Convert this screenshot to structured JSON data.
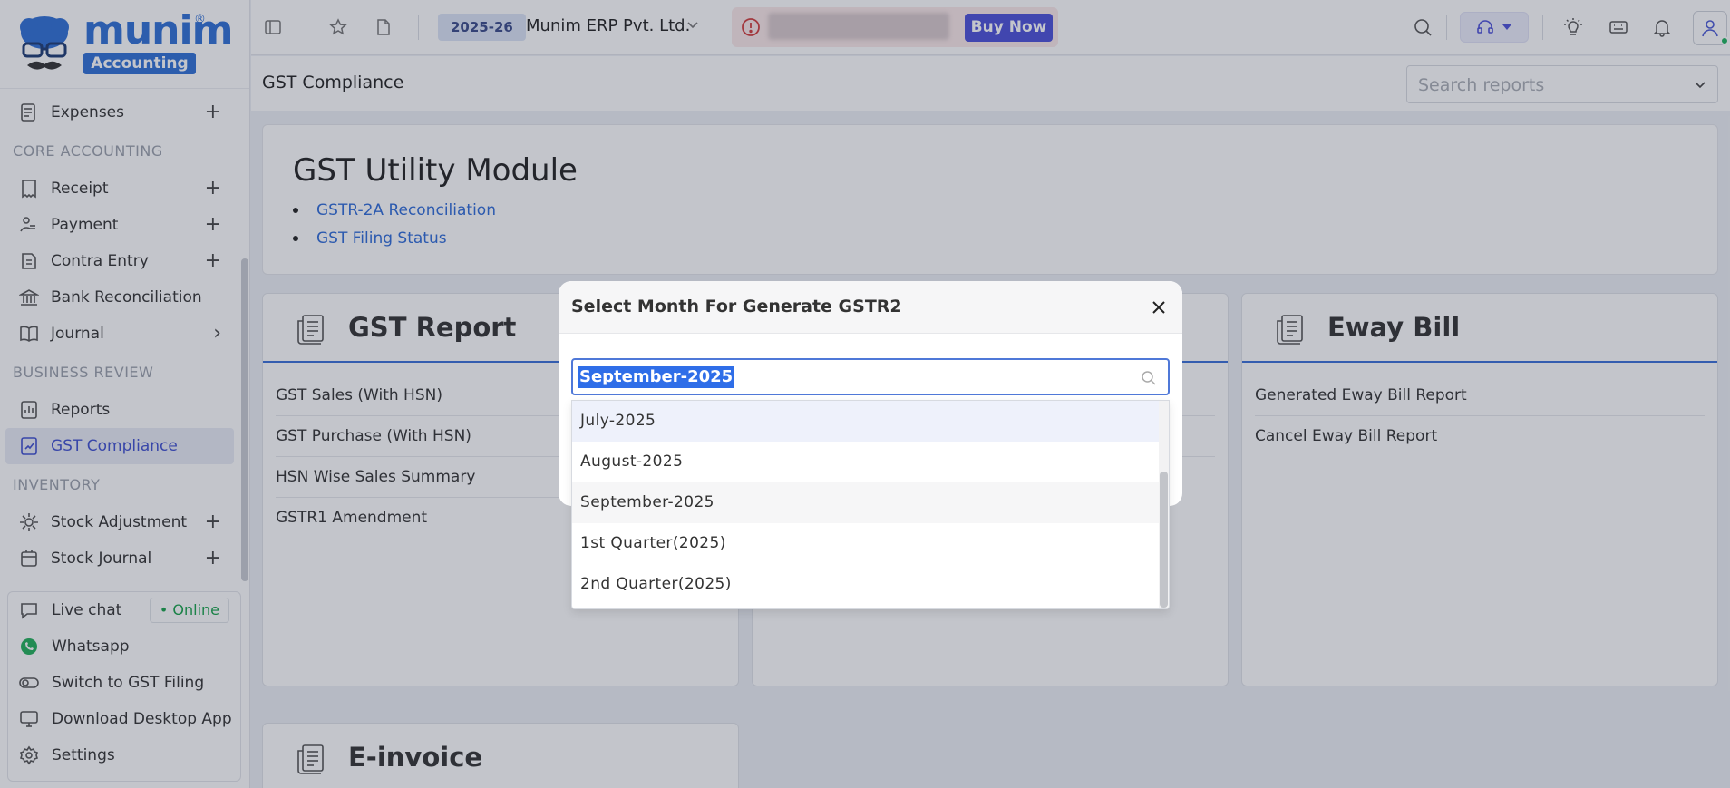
{
  "logo": {
    "name": "munim",
    "badge": "Accounting",
    "reg": "®"
  },
  "sidebar": {
    "items": [
      {
        "label": "Expenses",
        "plus": "+"
      },
      {
        "section": "CORE ACCOUNTING"
      },
      {
        "label": "Receipt",
        "plus": "+"
      },
      {
        "label": "Payment",
        "plus": "+"
      },
      {
        "label": "Contra Entry",
        "plus": "+"
      },
      {
        "label": "Bank Reconciliation"
      },
      {
        "label": "Journal",
        "chevron": "›"
      },
      {
        "section": "BUSINESS REVIEW"
      },
      {
        "label": "Reports"
      },
      {
        "label": "GST Compliance",
        "active": true
      },
      {
        "section": "INVENTORY"
      },
      {
        "label": "Stock Adjustment",
        "plus": "+"
      },
      {
        "label": "Stock Journal",
        "plus": "+"
      }
    ],
    "bottom": {
      "live_chat": "Live chat",
      "online": "• Online",
      "whatsapp": "Whatsapp",
      "switch_gst": "Switch to GST Filing",
      "download": "Download Desktop App",
      "settings": "Settings"
    }
  },
  "topbar": {
    "fy": "2025-26",
    "company": "Munim ERP Pvt. Ltd.",
    "buy_now": "Buy Now"
  },
  "header": {
    "title": "GST Compliance",
    "search_placeholder": "Search reports"
  },
  "utility": {
    "title": "GST Utility Module",
    "links": [
      "GSTR-2A Reconciliation",
      "GST Filing Status"
    ]
  },
  "cards": {
    "gst_report": {
      "title": "GST Report",
      "items": [
        "GST Sales (With HSN)",
        "GST Purchase (With HSN)",
        "HSN Wise Sales Summary",
        "GSTR1 Amendment"
      ]
    },
    "eway_bill": {
      "title": "Eway Bill",
      "items": [
        "Generated Eway Bill Report",
        "Cancel Eway Bill Report"
      ]
    },
    "einvoice": {
      "title": "E-invoice"
    }
  },
  "modal": {
    "title": "Select Month For Generate GSTR2",
    "input_value": "September-2025",
    "options": [
      "July-2025",
      "August-2025",
      "September-2025",
      "1st Quarter(2025)",
      "2nd Quarter(2025)"
    ]
  },
  "colors": {
    "accent": "#4b4fd8",
    "link": "#2e6bd8",
    "online": "#17a34a",
    "active_bg": "#e9ecf6"
  }
}
